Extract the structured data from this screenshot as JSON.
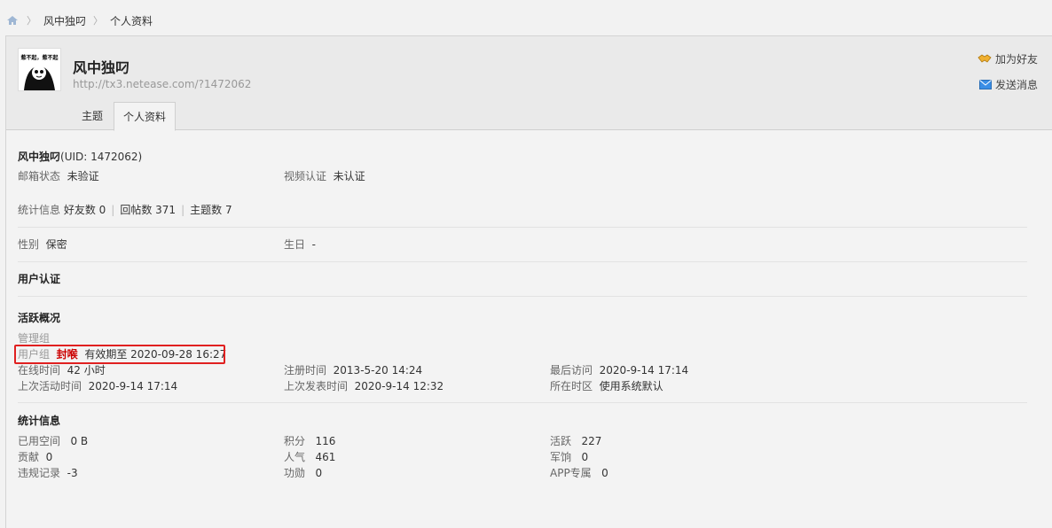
{
  "breadcrumb": {
    "items": [
      "风中独叼",
      "个人资料"
    ]
  },
  "profile": {
    "avatar_text": "惹不起，惹不起",
    "name": "风中独叼",
    "url": "http://tx3.netease.com/?1472062"
  },
  "actions": {
    "add_friend": "加为好友",
    "send_message": "发送消息"
  },
  "tabs": [
    {
      "label": "主题",
      "active": false
    },
    {
      "label": "个人资料",
      "active": true
    }
  ],
  "basic": {
    "name": "风中独叼",
    "uid": "(UID: 1472062)",
    "email_label": "邮箱状态",
    "email_value": "未验证",
    "video_label": "视频认证",
    "video_value": "未认证",
    "stats_label": "统计信息",
    "friends": "好友数 0",
    "replies": "回帖数 371",
    "topics": "主题数 7",
    "gender_label": "性别",
    "gender_value": "保密",
    "birthday_label": "生日",
    "birthday_value": "-"
  },
  "verification": {
    "title": "用户认证"
  },
  "activity": {
    "title": "活跃概况",
    "admin_group_label": "管理组",
    "user_group_label": "用户组",
    "user_group_value": "封喉",
    "user_group_expiry": "有效期至 2020-09-28 16:27",
    "online_label": "在线时间",
    "online_value": "42 小时",
    "register_label": "注册时间",
    "register_value": "2013-5-20 14:24",
    "last_visit_label": "最后访问",
    "last_visit_value": "2020-9-14 17:14",
    "last_active_label": "上次活动时间",
    "last_active_value": "2020-9-14 17:14",
    "last_post_label": "上次发表时间",
    "last_post_value": "2020-9-14 12:32",
    "timezone_label": "所在时区",
    "timezone_value": "使用系统默认"
  },
  "stats": {
    "title": "统计信息",
    "space_label": "已用空间",
    "space_value": "0 B",
    "points_label": "积分",
    "points_value": "116",
    "active_label": "活跃",
    "active_value": "227",
    "contrib_label": "贡献",
    "contrib_value": "0",
    "pop_label": "人气",
    "pop_value": "461",
    "pay_label": "军饷",
    "pay_value": "0",
    "violation_label": "违规记录",
    "violation_value": "-3",
    "merit_label": "功勋",
    "merit_value": "0",
    "app_label": "APP专属",
    "app_value": "0"
  }
}
